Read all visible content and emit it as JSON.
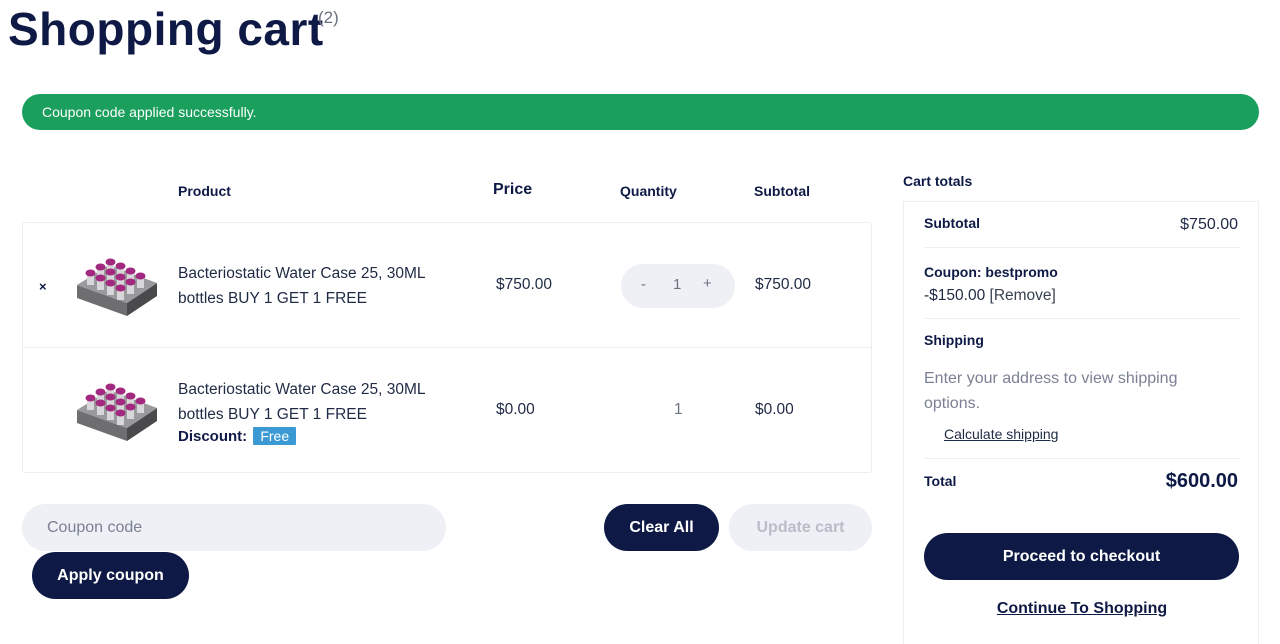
{
  "page": {
    "title": "Shopping cart",
    "count": "(2)"
  },
  "notice": {
    "message": "Coupon code applied successfully."
  },
  "table": {
    "headers": {
      "product": "Product",
      "price": "Price",
      "quantity": "Quantity",
      "subtotal": "Subtotal"
    },
    "rows": [
      {
        "remove": "×",
        "name": "Bacteriostatic Water Case 25, 30ML bottles BUY 1 GET 1 FREE",
        "price": "$750.00",
        "quantity": {
          "minus": "-",
          "value": "1",
          "plus": "+"
        },
        "subtotal": "$750.00"
      },
      {
        "name": "Bacteriostatic Water Case 25, 30ML bottles BUY 1 GET 1 FREE",
        "price": "$0.00",
        "quantity": "1",
        "subtotal": "$0.00",
        "discount_label": "Discount:",
        "discount_badge": "Free"
      }
    ]
  },
  "actions": {
    "coupon_placeholder": "Coupon code",
    "apply_label": "Apply coupon",
    "clear_label": "Clear All",
    "update_label": "Update cart"
  },
  "totals": {
    "title": "Cart totals",
    "subtotal_label": "Subtotal",
    "subtotal_value": "$750.00",
    "coupon_label": "Coupon: bestpromo",
    "coupon_amount": "-$150.00",
    "coupon_remove": "[Remove]",
    "shipping_label": "Shipping",
    "shipping_note": "Enter your address to view shipping options.",
    "calculate_link": "Calculate shipping",
    "total_label": "Total",
    "total_value": "$600.00",
    "checkout_label": "Proceed to checkout",
    "continue_label": "Continue To Shopping"
  },
  "colors": {
    "primary": "#0e1a45",
    "success": "#1a9f5c",
    "badge": "#3b9ad3",
    "muted_bg": "#eef0f5"
  },
  "icons": {
    "product_image": "vial-tray-icon",
    "remove": "close-icon"
  }
}
